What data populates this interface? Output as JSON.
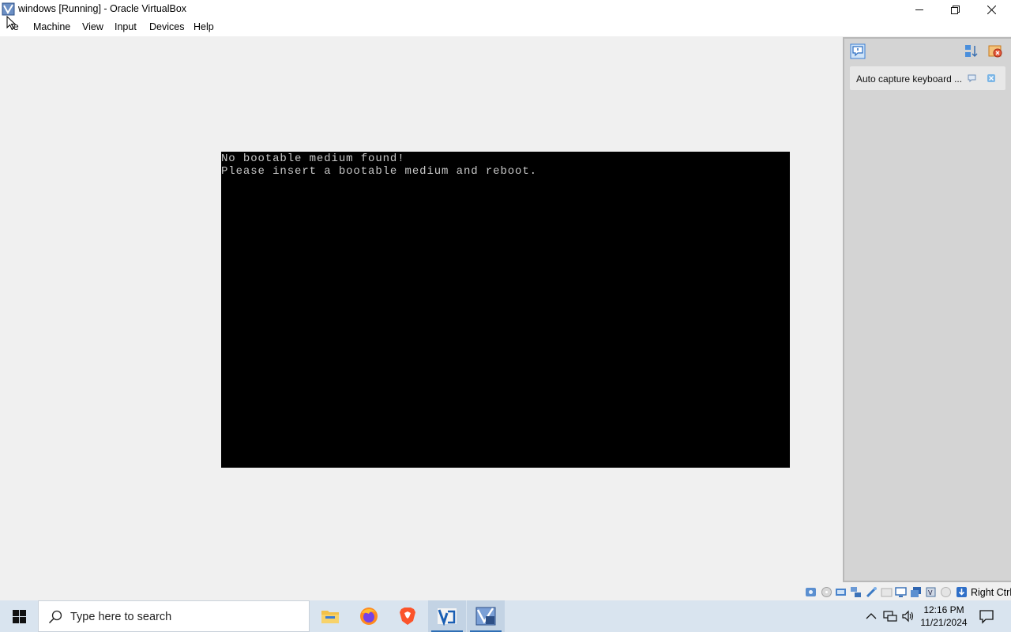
{
  "window": {
    "title": "windows [Running] - Oracle VirtualBox"
  },
  "menu": {
    "items": [
      "le",
      "Machine",
      "View",
      "Input",
      "Devices",
      "Help"
    ]
  },
  "vm_screen": {
    "lines": [
      "No bootable medium found!",
      "Please insert a bootable medium and reboot."
    ]
  },
  "side_panel": {
    "notification": "Auto capture keyboard ..."
  },
  "statusbar": {
    "host_key": "Right Ctrl"
  },
  "taskbar": {
    "search_placeholder": "Type here to search",
    "time": "12:16 PM",
    "date": "11/21/2024"
  },
  "colors": {
    "vm_background": "#f0f0f0",
    "screen_background": "#000000",
    "screen_text": "#c8c8c8",
    "taskbar": "#d9e4ef",
    "accent": "#2f6fb5"
  },
  "icons": {
    "taskbar_apps": [
      "file-explorer-icon",
      "firefox-icon",
      "brave-icon",
      "virtualbox-manager-icon",
      "virtualbox-vm-icon"
    ],
    "tray": [
      "chevron-up-icon",
      "network-icon",
      "volume-icon",
      "notification-icon"
    ]
  }
}
